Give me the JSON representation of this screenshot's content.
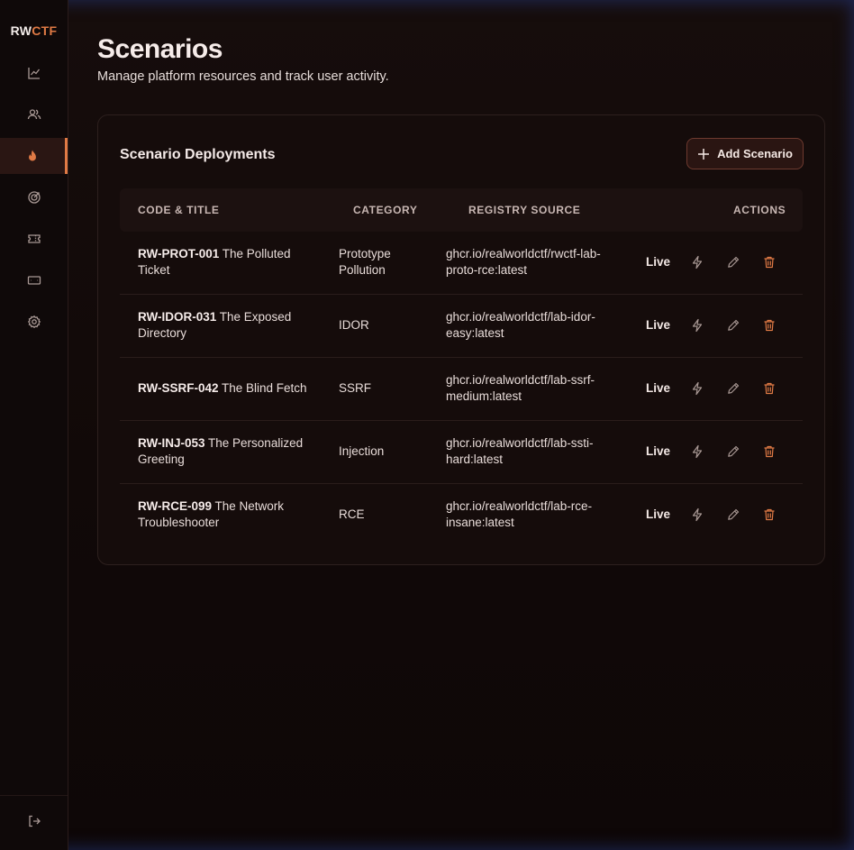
{
  "brand": {
    "part1": "RW",
    "part2": "CTF",
    "accent": "#e07a45"
  },
  "sidebar": {
    "items": [
      {
        "icon": "chart-line-icon",
        "active": false
      },
      {
        "icon": "users-icon",
        "active": false
      },
      {
        "icon": "flame-icon",
        "active": true
      },
      {
        "icon": "target-icon",
        "active": false
      },
      {
        "icon": "ticket-icon",
        "active": false
      },
      {
        "icon": "card-icon",
        "active": false
      },
      {
        "icon": "gear-icon",
        "active": false
      }
    ],
    "footer_icon": "logout-icon"
  },
  "page": {
    "title": "Scenarios",
    "subtitle": "Manage platform resources and track user activity."
  },
  "card": {
    "title": "Scenario Deployments",
    "add_button": "Add Scenario"
  },
  "table": {
    "headers": {
      "code_title": "CODE & TITLE",
      "category": "CATEGORY",
      "registry": "REGISTRY SOURCE",
      "actions": "ACTIONS"
    },
    "rows": [
      {
        "code": "RW-PROT-001",
        "title_l1": "The Polluted",
        "title_l2": "Ticket",
        "category_l1": "Prototype",
        "category_l2": "Pollution",
        "registry_l1": "ghcr.io/realworldctf/rwctf-lab-",
        "registry_l2": "proto-rce:latest",
        "status": "Live"
      },
      {
        "code": "RW-IDOR-031",
        "title_l1": "The Exposed",
        "title_l2": "Directory",
        "category_l1": "IDOR",
        "category_l2": "",
        "registry_l1": "ghcr.io/realworldctf/lab-idor-",
        "registry_l2": "easy:latest",
        "status": "Live"
      },
      {
        "code": "RW-SSRF-042",
        "title_l1": "The Blind Fetch",
        "title_l2": "",
        "category_l1": "SSRF",
        "category_l2": "",
        "registry_l1": "ghcr.io/realworldctf/lab-ssrf-",
        "registry_l2": "medium:latest",
        "status": "Live"
      },
      {
        "code": "RW-INJ-053",
        "title_l1": "The Personalized",
        "title_l2": "Greeting",
        "category_l1": "Injection",
        "category_l2": "",
        "registry_l1": "ghcr.io/realworldctf/lab-ssti-",
        "registry_l2": "hard:latest",
        "status": "Live"
      },
      {
        "code": "RW-RCE-099",
        "title_l1": "The Network",
        "title_l2": "Troubleshooter",
        "category_l1": "RCE",
        "category_l2": "",
        "registry_l1": "ghcr.io/realworldctf/lab-rce-",
        "registry_l2": "insane:latest",
        "status": "Live"
      }
    ],
    "row_action_icons": [
      "lightning-icon",
      "pencil-icon",
      "trash-icon"
    ]
  }
}
